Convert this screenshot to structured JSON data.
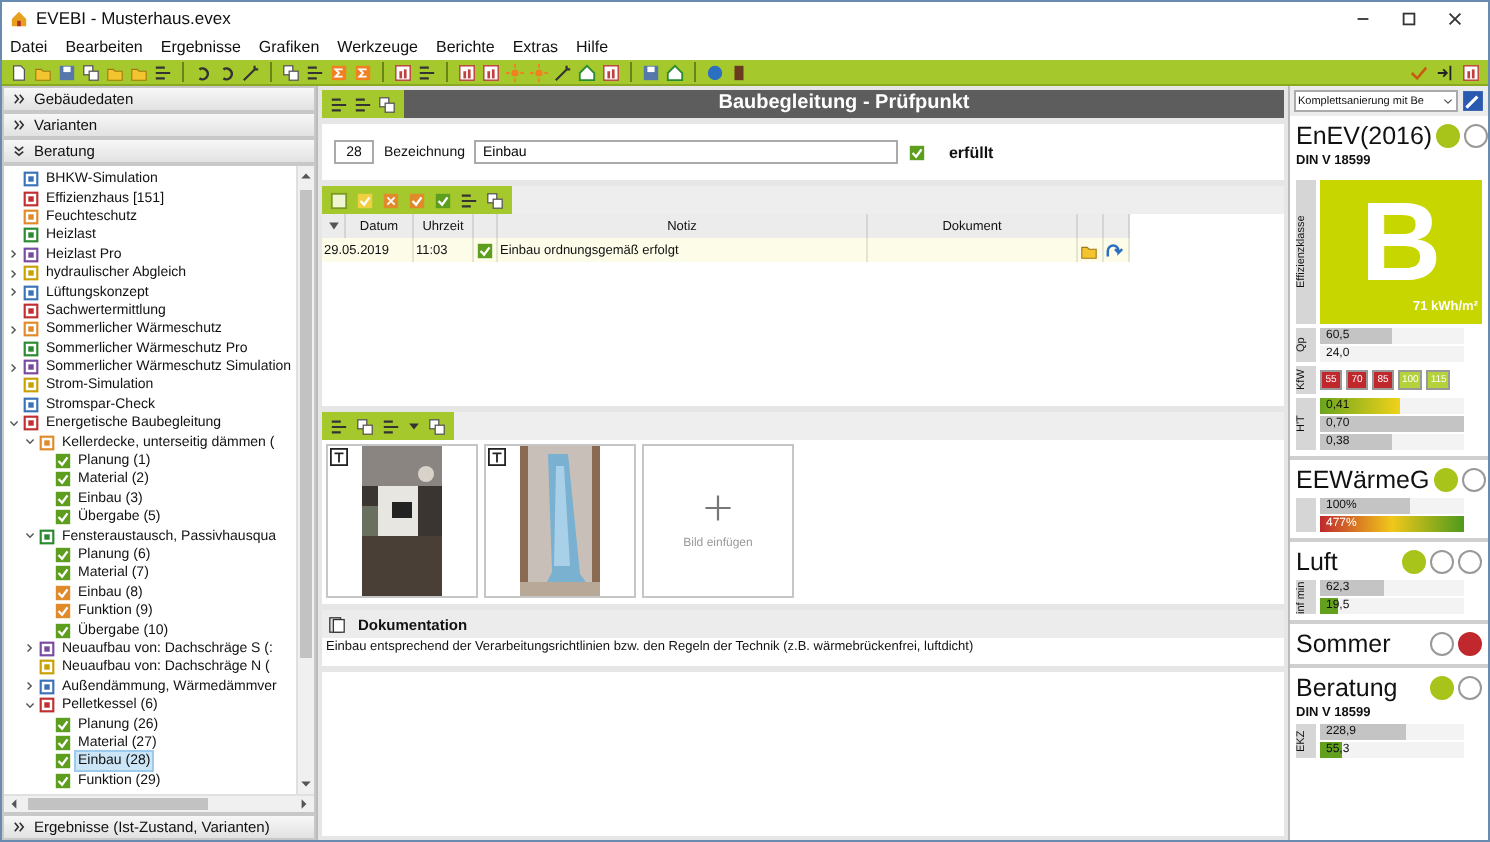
{
  "window": {
    "title": "EVEBI - Musterhaus.evex"
  },
  "menu": [
    "Datei",
    "Bearbeiten",
    "Ergebnisse",
    "Grafiken",
    "Werkzeuge",
    "Berichte",
    "Extras",
    "Hilfe"
  ],
  "sidebar": {
    "sections": [
      {
        "label": "Gebäudedaten",
        "expanded": false
      },
      {
        "label": "Varianten",
        "expanded": false
      },
      {
        "label": "Beratung",
        "expanded": true
      }
    ],
    "tree": [
      {
        "label": "BHKW-Simulation",
        "kind": "tool",
        "selected": false
      },
      {
        "label": "Effizienzhaus [151]",
        "kind": "tool",
        "selected": false
      },
      {
        "label": "Feuchteschutz",
        "kind": "tool",
        "selected": false
      },
      {
        "label": "Heizlast",
        "kind": "tool",
        "selected": false
      },
      {
        "label": "Heizlast Pro",
        "kind": "tool",
        "selected": false,
        "expanded": false
      },
      {
        "label": "hydraulischer Abgleich",
        "kind": "tool",
        "selected": false,
        "expanded": false
      },
      {
        "label": "Lüftungskonzept",
        "kind": "tool",
        "selected": false,
        "expanded": false
      },
      {
        "label": "Sachwertermittlung",
        "kind": "tool",
        "selected": false
      },
      {
        "label": "Sommerlicher Wärmeschutz",
        "kind": "tool",
        "selected": false,
        "expanded": false
      },
      {
        "label": "Sommerlicher Wärmeschutz Pro",
        "kind": "tool",
        "selected": false
      },
      {
        "label": "Sommerlicher Wärmeschutz Simulation",
        "kind": "tool",
        "selected": false,
        "expanded": false
      },
      {
        "label": "Strom-Simulation",
        "kind": "tool",
        "selected": false
      },
      {
        "label": "Stromspar-Check",
        "kind": "tool",
        "selected": false
      },
      {
        "label": "Energetische Baubegleitung",
        "kind": "tool",
        "selected": false,
        "expanded": true,
        "children": [
          {
            "label": "Kellerdecke, unterseitig dämmen (",
            "kind": "tool",
            "selected": false,
            "expanded": true,
            "children": [
              {
                "label": "Planung (1)",
                "kind": "check",
                "color": "#5e9e1e",
                "selected": false
              },
              {
                "label": "Material (2)",
                "kind": "check",
                "color": "#5e9e1e",
                "selected": false
              },
              {
                "label": "Einbau (3)",
                "kind": "check",
                "color": "#5e9e1e",
                "selected": false
              },
              {
                "label": "Übergabe (5)",
                "kind": "check",
                "color": "#5e9e1e",
                "selected": false
              }
            ]
          },
          {
            "label": "Fensteraustausch, Passivhausqua",
            "kind": "tool",
            "selected": false,
            "expanded": true,
            "children": [
              {
                "label": "Planung (6)",
                "kind": "check",
                "color": "#5e9e1e",
                "selected": false
              },
              {
                "label": "Material (7)",
                "kind": "check",
                "color": "#5e9e1e",
                "selected": false
              },
              {
                "label": "Einbau (8)",
                "kind": "check",
                "color": "#e08a2a",
                "selected": false
              },
              {
                "label": "Funktion (9)",
                "kind": "check",
                "color": "#e08a2a",
                "selected": false
              },
              {
                "label": "Übergabe (10)",
                "kind": "check",
                "color": "#5e9e1e",
                "selected": false
              }
            ]
          },
          {
            "label": "Neuaufbau von: Dachschräge S (:",
            "kind": "tool",
            "selected": false,
            "expanded": false
          },
          {
            "label": "Neuaufbau von: Dachschräge N (",
            "kind": "tool",
            "selected": false
          },
          {
            "label": "Außendämmung, Wärmedämmver",
            "kind": "tool",
            "selected": false,
            "expanded": false
          },
          {
            "label": "Pelletkessel (6)",
            "kind": "tool",
            "selected": false,
            "expanded": true,
            "children": [
              {
                "label": "Planung (26)",
                "kind": "check",
                "color": "#5e9e1e",
                "selected": false
              },
              {
                "label": "Material (27)",
                "kind": "check",
                "color": "#5e9e1e",
                "selected": false
              },
              {
                "label": "Einbau (28)",
                "kind": "check",
                "color": "#5e9e1e",
                "selected": true
              },
              {
                "label": "Funktion (29)",
                "kind": "check",
                "color": "#5e9e1e",
                "selected": false
              }
            ]
          }
        ]
      }
    ],
    "footer": {
      "label": "Ergebnisse (Ist-Zustand, Varianten)",
      "expanded": false
    }
  },
  "panel": {
    "title": "Baubegleitung - Prüfpunkt",
    "number": "28",
    "name_label": "Bezeichnung",
    "name_value": "Einbau",
    "fulfilled": {
      "label": "erfüllt",
      "checked": true
    }
  },
  "table": {
    "columns": [
      "Datum",
      "Uhrzeit",
      "Notiz",
      "Dokument"
    ],
    "rows": [
      {
        "date": "29.05.2019",
        "time": "11:03",
        "checked": true,
        "note": "Einbau ordnungsgemäß erfolgt"
      }
    ]
  },
  "photos": {
    "add_label": "Bild einfügen"
  },
  "documentation": {
    "title": "Dokumentation",
    "text": "Einbau entsprechend der Verarbeitungsrichtlinien bzw. den Regeln der Technik (z.B. wärmebrückenfrei, luftdicht)"
  },
  "rating": {
    "variant": "Komplettsanierung mit Be",
    "enev": {
      "title": "EnEV(2016)",
      "subtitle": "DIN V 18599",
      "lights": [
        {
          "on": true,
          "color": "#a8c41a"
        },
        {
          "on": false
        }
      ],
      "class_label": "Effizienzklasse",
      "class": "B",
      "value": "71 kWh/m²",
      "qp": {
        "label": "Qp",
        "bars": [
          {
            "text": "60,5",
            "level": 0.5
          },
          {
            "text": "24,0"
          }
        ]
      },
      "kfw": {
        "label": "KfW",
        "classes": [
          {
            "text": "55",
            "color": "#c0282d"
          },
          {
            "text": "70",
            "color": "#c0282d"
          },
          {
            "text": "85",
            "color": "#c0282d"
          },
          {
            "text": "100",
            "color": "#b4d23c"
          },
          {
            "text": "115",
            "color": "#b4d23c"
          }
        ]
      },
      "ht": {
        "label": "H'T",
        "bars": [
          {
            "text": "0,41",
            "level": 0.55,
            "kind": "gradient"
          },
          {
            "text": "0,70",
            "level": 1
          },
          {
            "text": "0,38",
            "level": 0.5
          }
        ]
      }
    },
    "eewaermeg": {
      "title": "EEWärmeG",
      "lights": [
        {
          "on": true,
          "color": "#a8c41a"
        },
        {
          "on": false
        }
      ],
      "bars": [
        {
          "text": "100%",
          "level": 0.62
        },
        {
          "text": "477%",
          "level": 1,
          "kind": "heat"
        }
      ]
    },
    "luft": {
      "title": "Luft",
      "lights": [
        {
          "on": true,
          "color": "#a8c41a"
        },
        {
          "on": false
        },
        {
          "on": false
        }
      ],
      "label": "inf min",
      "bars": [
        {
          "text": "62,3",
          "level": 0.45
        },
        {
          "text": "19,5",
          "level": 0.12,
          "kind": "green"
        }
      ]
    },
    "sommer": {
      "title": "Sommer",
      "lights": [
        {
          "on": false
        },
        {
          "on": true,
          "color": "#c0282d"
        }
      ]
    },
    "beratung": {
      "title": "Beratung",
      "subtitle": "DIN V 18599",
      "lights": [
        {
          "on": true,
          "color": "#a8c41a"
        },
        {
          "on": false
        }
      ],
      "label": "EKZ",
      "bars": [
        {
          "text": "228,9",
          "level": 0.6
        },
        {
          "text": "55,3",
          "level": 0.15,
          "kind": "green"
        }
      ]
    }
  }
}
